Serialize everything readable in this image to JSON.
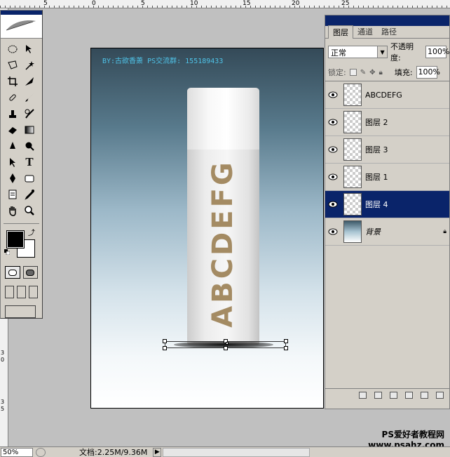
{
  "ruler_top": {
    "numbers": [
      "5",
      "0",
      "5",
      "10",
      "15",
      "20",
      "25"
    ]
  },
  "ruler_left": {
    "numbers": [
      "3",
      "0",
      "3",
      "5"
    ]
  },
  "toolbox": {
    "tools": [
      "marquee-icon",
      "move-icon",
      "lasso-icon",
      "magic-wand-icon",
      "crop-icon",
      "slice-icon",
      "healing-brush-icon",
      "brush-icon",
      "clone-stamp-icon",
      "history-brush-icon",
      "eraser-icon",
      "gradient-icon",
      "blur-icon",
      "dodge-icon",
      "path-selection-icon",
      "type-icon",
      "pen-icon",
      "shape-icon",
      "notes-icon",
      "eyedropper-icon",
      "hand-icon",
      "zoom-icon"
    ],
    "foreground_color": "#000000",
    "background_color": "#ffffff"
  },
  "canvas": {
    "watermark": "BY:古欲香萧 PS交流群: 155189433",
    "bottle_text": "ABCDEFG",
    "text_color": "#a48b63"
  },
  "layers_panel": {
    "tabs": [
      "图层",
      "通道",
      "路径"
    ],
    "blend_mode": "正常",
    "opacity_label": "不透明度:",
    "opacity_value": "100%",
    "lock_label": "锁定:",
    "fill_label": "填充:",
    "fill_value": "100%",
    "layers": [
      {
        "name": "ABCDEFG",
        "selected": false
      },
      {
        "name": "图层 2",
        "selected": false
      },
      {
        "name": "图层 3",
        "selected": false
      },
      {
        "name": "图层 1",
        "selected": false
      },
      {
        "name": "图层 4",
        "selected": true
      },
      {
        "name": "背景",
        "selected": false
      }
    ]
  },
  "statusbar": {
    "zoom": "50%",
    "doc_info": "文档:2.25M/9.36M"
  },
  "site_watermark": {
    "line1": "PS爱好者教程网",
    "line2": "www.psahz.com"
  }
}
